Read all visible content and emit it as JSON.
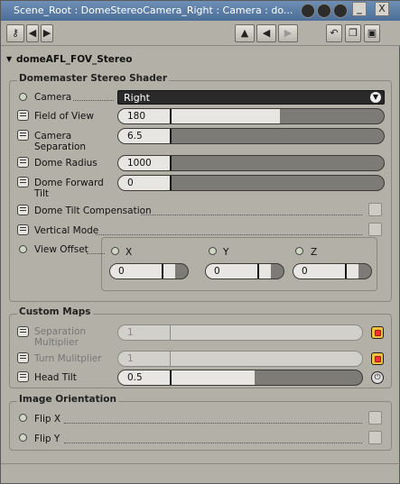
{
  "window": {
    "title": "Scene_Root : DomeStereoCamera_Right : Camera : do..."
  },
  "titlebar_buttons": {
    "help": "?",
    "close": "X"
  },
  "toolbar": {
    "lock_icon": "lock-icon",
    "nav_left": "◀",
    "nav_right": "▶",
    "up": "▲",
    "back": "◀",
    "forward": "▶"
  },
  "property_page": {
    "title": "domeAFL_FOV_Stereo"
  },
  "groups": {
    "shader": "Domemaster Stereo Shader",
    "custom_maps": "Custom Maps",
    "orientation": "Image Orientation"
  },
  "params": {
    "camera": {
      "label": "Camera",
      "value": "Right"
    },
    "fov": {
      "label": "Field of View",
      "value": "180",
      "fraction": 0.61
    },
    "separation": {
      "label": "Camera Separation",
      "label1": "Camera",
      "label2": "Separation",
      "value": "6.5",
      "fraction": 0.2
    },
    "dome_radius": {
      "label": "Dome Radius",
      "value": "1000",
      "fraction": 0.2
    },
    "dome_tilt": {
      "label": "Dome Forward Tilt",
      "label1": "Dome Forward",
      "label2": "Tilt",
      "value": "0",
      "fraction": 0.2
    },
    "tilt_comp": {
      "label": "Dome Tilt Compensation"
    },
    "vertical_mode": {
      "label": "Vertical Mode"
    },
    "view_offset": {
      "label": "View Offset",
      "x": {
        "label": "X",
        "value": "0"
      },
      "y": {
        "label": "Y",
        "value": "0"
      },
      "z": {
        "label": "Z",
        "value": "0"
      }
    },
    "sep_mult": {
      "label": "Separation Multiplier",
      "label1": "Separation",
      "label2": "Multiplier",
      "value": "1"
    },
    "turn_mult": {
      "label": "Turn Mulitplier",
      "value": "1"
    },
    "head_tilt": {
      "label": "Head Tilt",
      "value": "0.5",
      "fraction": 0.56
    },
    "flip_x": {
      "label": "Flip X"
    },
    "flip_y": {
      "label": "Flip Y"
    }
  }
}
